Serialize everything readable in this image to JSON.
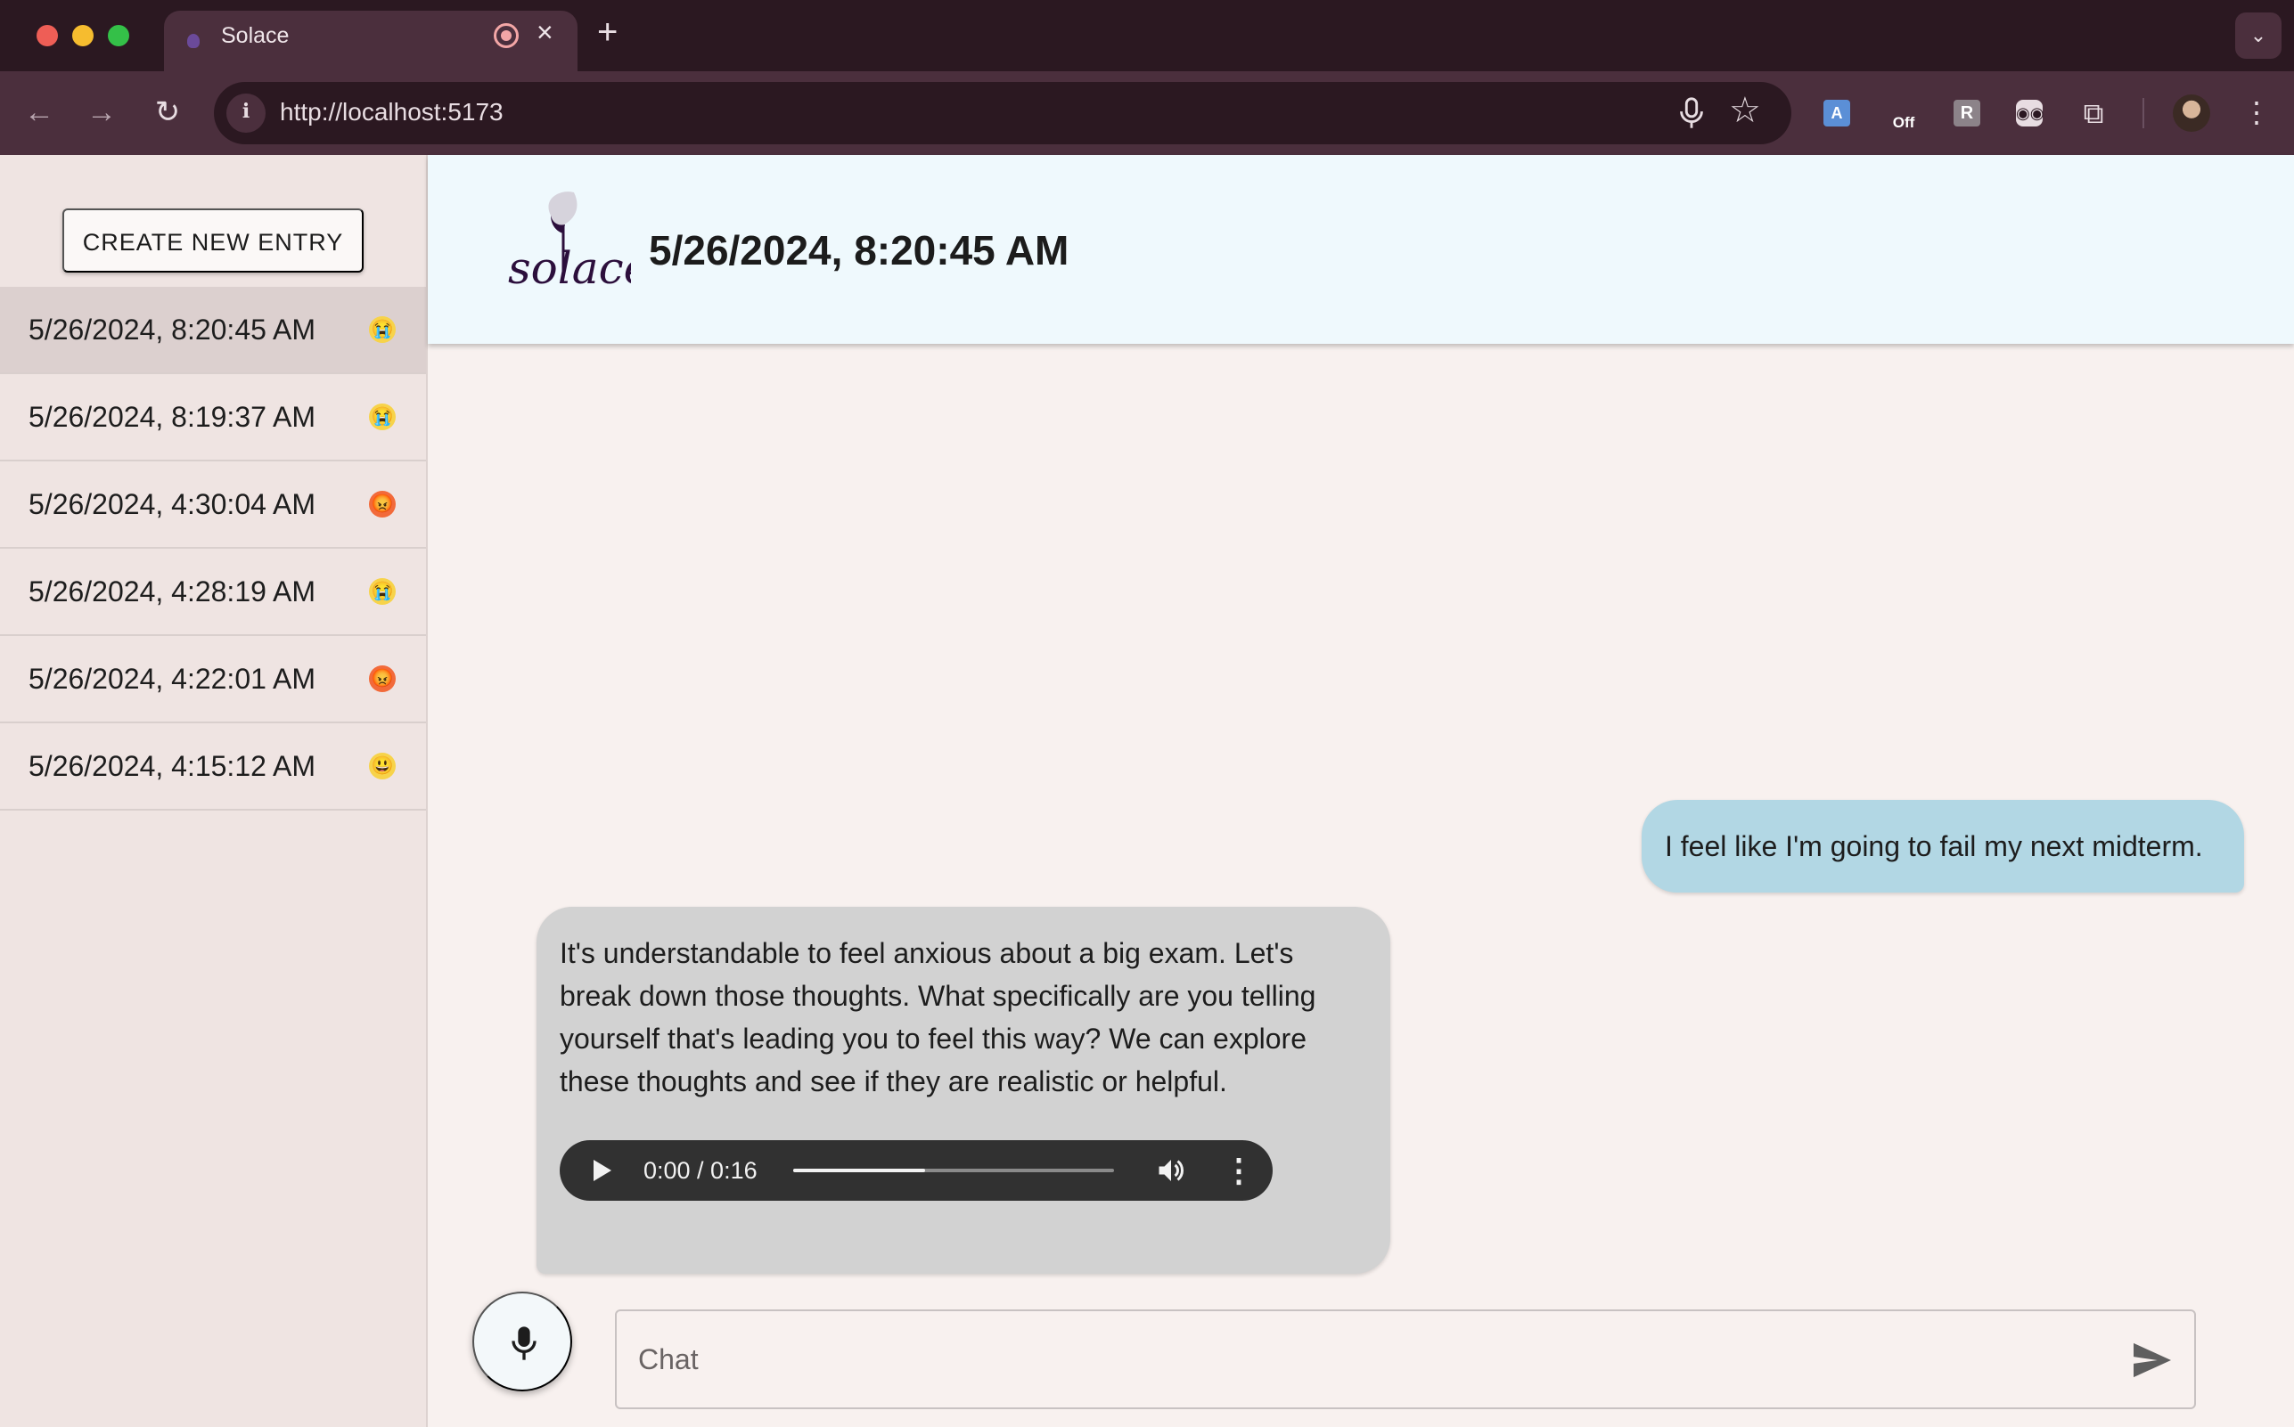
{
  "browser": {
    "tab_title": "Solace",
    "url": "http://localhost:5173",
    "extension_off_label": "Off",
    "extension_r_label": "R",
    "extension_a_label": "A"
  },
  "sidebar": {
    "create_button_label": "CREATE NEW ENTRY",
    "entries": [
      {
        "date": "5/26/2024, 8:20:45 AM",
        "mood": "crying",
        "emoji": "😭",
        "selected": true
      },
      {
        "date": "5/26/2024, 8:19:37 AM",
        "mood": "crying",
        "emoji": "😭",
        "selected": false
      },
      {
        "date": "5/26/2024, 4:30:04 AM",
        "mood": "angry",
        "emoji": "😡",
        "selected": false
      },
      {
        "date": "5/26/2024, 4:28:19 AM",
        "mood": "crying",
        "emoji": "😭",
        "selected": false
      },
      {
        "date": "5/26/2024, 4:22:01 AM",
        "mood": "angry",
        "emoji": "😡",
        "selected": false
      },
      {
        "date": "5/26/2024, 4:15:12 AM",
        "mood": "smile",
        "emoji": "😃",
        "selected": false
      }
    ]
  },
  "header": {
    "logo_text": "solace",
    "title": "5/26/2024, 8:20:45 AM"
  },
  "messages": {
    "user": "I feel like I'm going to fail my next midterm.",
    "bot": "It's understandable to feel anxious about a big exam. Let's break down those thoughts. What specifically are you telling yourself that's leading you to feel this way? We can explore these thoughts and see if they are realistic or helpful.",
    "audio_time": "0:00 / 0:16",
    "audio_buffered_fraction": 0.41
  },
  "composer": {
    "placeholder": "Chat"
  },
  "colors": {
    "header_bg": "#eff9fd",
    "user_bubble": "#b2d7e4",
    "bot_bubble": "#d2d2d2",
    "sidebar_bg": "#efe4e2",
    "selected_entry": "#dcd0cf"
  }
}
